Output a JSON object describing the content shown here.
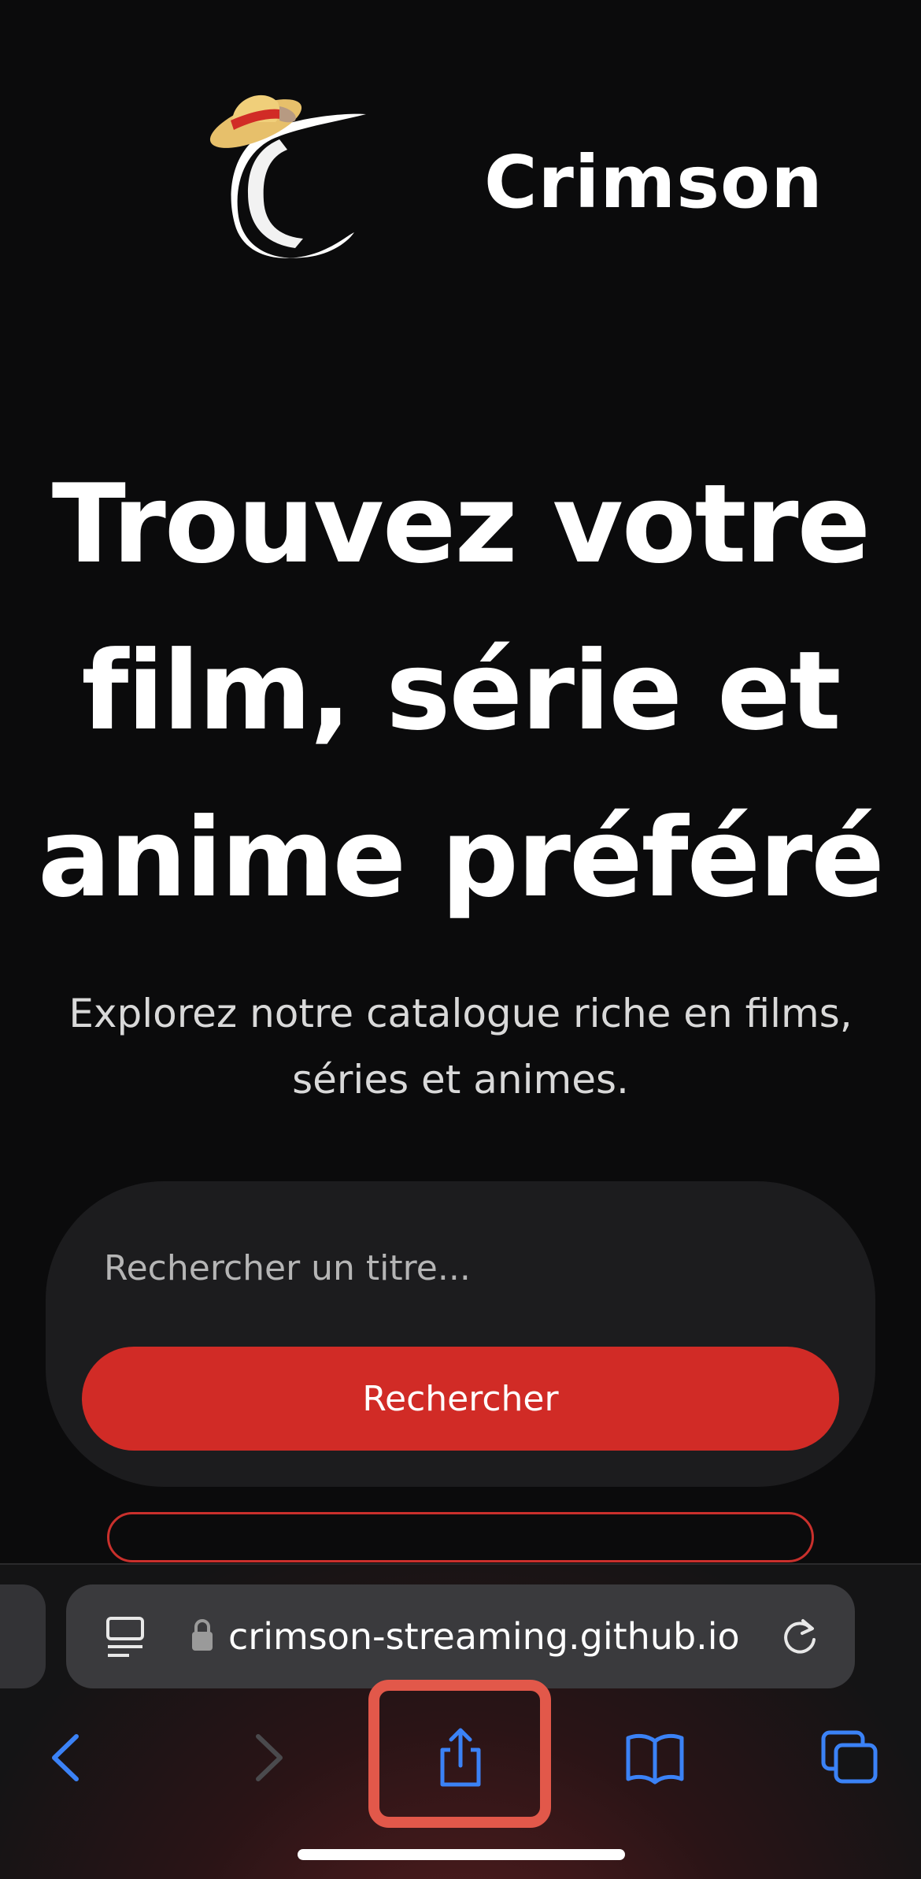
{
  "brand": {
    "name": "Crimson"
  },
  "hero": {
    "title_lines": [
      "Trouvez votre",
      "film, série et",
      "anime préféré"
    ],
    "subtitle": "Explorez notre catalogue riche en films, séries et animes."
  },
  "search": {
    "placeholder": "Rechercher un titre...",
    "button_label": "Rechercher"
  },
  "browser": {
    "url": "crimson-streaming.github.io",
    "toolbar": {
      "back_icon": "chevron-left-icon",
      "forward_icon": "chevron-right-icon",
      "share_icon": "share-icon",
      "bookmarks_icon": "book-icon",
      "tabs_icon": "tabs-icon"
    }
  },
  "colors": {
    "background": "#0b0b0c",
    "card": "#1c1c1e",
    "accent": "#d12b26",
    "toolbar_icon": "#3b82f6",
    "highlight": "#e2584a"
  }
}
